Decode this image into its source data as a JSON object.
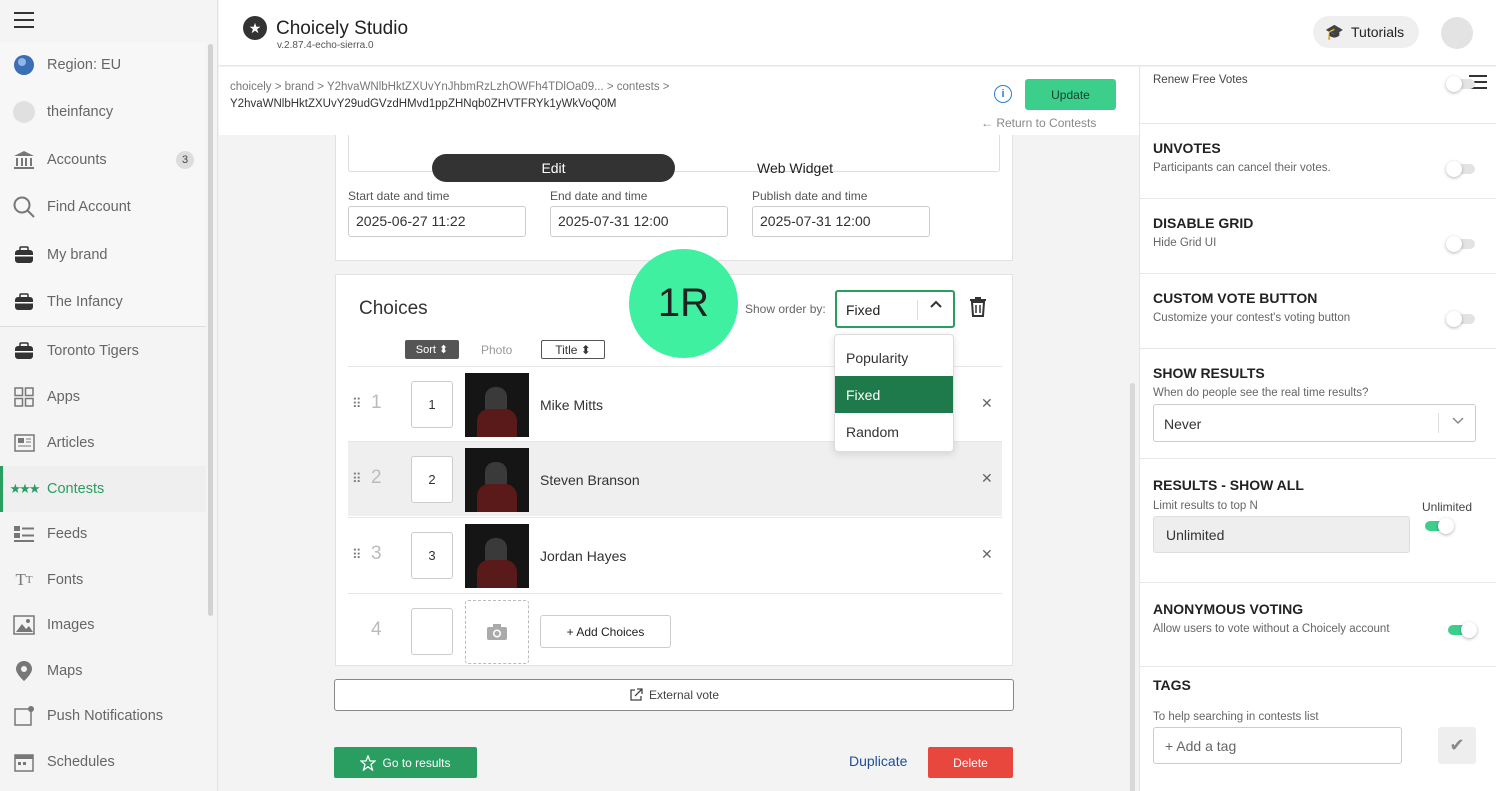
{
  "sidebar": {
    "items": [
      {
        "label": "Region: EU",
        "icon": "globe-icon"
      },
      {
        "label": "theinfancy",
        "icon": "avatar-icon"
      },
      {
        "label": "Accounts",
        "icon": "bank-icon",
        "badge": "3"
      },
      {
        "label": "Find Account",
        "icon": "search-icon"
      },
      {
        "label": "My brand",
        "icon": "briefcase-icon"
      },
      {
        "label": "The Infancy",
        "icon": "briefcase-icon"
      },
      {
        "label": "Toronto Tigers",
        "icon": "briefcase-icon"
      },
      {
        "label": "Apps",
        "icon": "grid-icon"
      },
      {
        "label": "Articles",
        "icon": "article-icon"
      },
      {
        "label": "Contests",
        "icon": "stars-icon",
        "active": true
      },
      {
        "label": "Feeds",
        "icon": "feed-icon"
      },
      {
        "label": "Fonts",
        "icon": "font-icon"
      },
      {
        "label": "Images",
        "icon": "image-icon"
      },
      {
        "label": "Maps",
        "icon": "map-pin-icon"
      },
      {
        "label": "Push Notifications",
        "icon": "notification-icon"
      },
      {
        "label": "Schedules",
        "icon": "calendar-icon"
      }
    ]
  },
  "header": {
    "title": "Choicely Studio",
    "version": "v.2.87.4-echo-sierra.0",
    "tutorials_label": "Tutorials"
  },
  "breadcrumb": {
    "line1": "choicely > brand > Y2hvaWNlbHktZXUvYnJhbmRzLzhOWFh4TDlOa09... > contests >",
    "line2": "Y2hvaWNlbHktZXUvY29udGVzdHMvd1ppZHNqb0ZHVTFRYk1yWkVoQ0M"
  },
  "actions": {
    "update_label": "Update",
    "return_label": "← Return to Contests"
  },
  "editor": {
    "edit_tab": "Edit",
    "widget_tab": "Web Widget",
    "start_label": "Start date and time",
    "start_value": "2025-06-27 11:22",
    "end_label": "End date and time",
    "end_value": "2025-07-31 12:00",
    "publish_label": "Publish date and time",
    "publish_value": "2025-07-31 12:00"
  },
  "choices": {
    "title": "Choices",
    "step_badge": "1R",
    "show_order_label": "Show order by:",
    "order_value": "Fixed",
    "order_options": [
      "Popularity",
      "Fixed",
      "Random"
    ],
    "col_sort": "Sort ⬍",
    "col_photo": "Photo",
    "col_title": "Title ⬍",
    "rows": [
      {
        "num": "1",
        "sort": "1",
        "name": "Mike Mitts"
      },
      {
        "num": "2",
        "sort": "2",
        "name": "Steven Branson"
      },
      {
        "num": "3",
        "sort": "3",
        "name": "Jordan Hayes"
      }
    ],
    "new_num": "4",
    "add_label": "+ Add Choices"
  },
  "footer": {
    "external_vote": "External vote",
    "results_label": "Go to results",
    "duplicate_label": "Duplicate",
    "delete_label": "Delete"
  },
  "settings": {
    "renew": {
      "title": "Renew Free Votes"
    },
    "unvotes": {
      "title": "UNVOTES",
      "desc": "Participants can cancel their votes.",
      "on": false
    },
    "grid": {
      "title": "DISABLE GRID",
      "desc": "Hide Grid UI",
      "on": false
    },
    "custom_btn": {
      "title": "CUSTOM VOTE BUTTON",
      "desc": "Customize your contest's voting button",
      "on": false
    },
    "show_results": {
      "title": "SHOW RESULTS",
      "desc": "When do people see the real time results?",
      "value": "Never"
    },
    "results_all": {
      "title": "RESULTS - SHOW ALL",
      "desc": "Limit results to top N",
      "value": "Unlimited",
      "toggle_label": "Unlimited",
      "on": true
    },
    "anonymous": {
      "title": "ANONYMOUS VOTING",
      "desc": "Allow users to vote without a Choicely account",
      "on": true
    },
    "tags": {
      "title": "TAGS",
      "desc": "To help searching in contests list",
      "placeholder": "+ Add a tag"
    }
  },
  "colors": {
    "accent": "#2a9d61",
    "update": "#3ccf8c",
    "badge": "#3ff0a0",
    "delete": "#e8473e"
  }
}
